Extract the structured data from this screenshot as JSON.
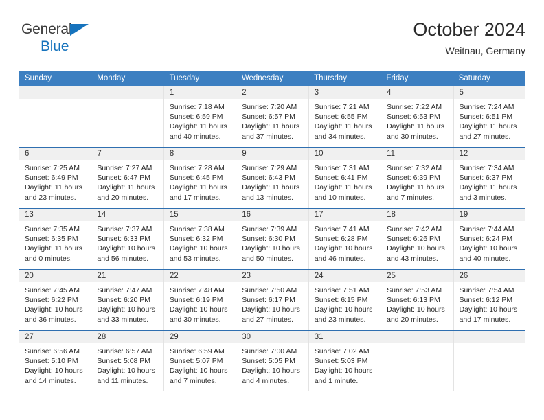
{
  "brand": {
    "name_line1": "General",
    "name_line2": "Blue",
    "color_dark": "#3a3a3a",
    "color_blue": "#1673bd"
  },
  "header": {
    "title": "October 2024",
    "subtitle": "Weitnau, Germany"
  },
  "theme": {
    "header_row_bg": "#3c7fc1",
    "week_divider": "#2f6fb0",
    "day_band_bg": "#f0f0f0"
  },
  "weekdays": [
    "Sunday",
    "Monday",
    "Tuesday",
    "Wednesday",
    "Thursday",
    "Friday",
    "Saturday"
  ],
  "weeks": [
    [
      {
        "day": "",
        "sunrise": "",
        "sunset": "",
        "daylight": ""
      },
      {
        "day": "",
        "sunrise": "",
        "sunset": "",
        "daylight": ""
      },
      {
        "day": "1",
        "sunrise": "Sunrise: 7:18 AM",
        "sunset": "Sunset: 6:59 PM",
        "daylight": "Daylight: 11 hours and 40 minutes."
      },
      {
        "day": "2",
        "sunrise": "Sunrise: 7:20 AM",
        "sunset": "Sunset: 6:57 PM",
        "daylight": "Daylight: 11 hours and 37 minutes."
      },
      {
        "day": "3",
        "sunrise": "Sunrise: 7:21 AM",
        "sunset": "Sunset: 6:55 PM",
        "daylight": "Daylight: 11 hours and 34 minutes."
      },
      {
        "day": "4",
        "sunrise": "Sunrise: 7:22 AM",
        "sunset": "Sunset: 6:53 PM",
        "daylight": "Daylight: 11 hours and 30 minutes."
      },
      {
        "day": "5",
        "sunrise": "Sunrise: 7:24 AM",
        "sunset": "Sunset: 6:51 PM",
        "daylight": "Daylight: 11 hours and 27 minutes."
      }
    ],
    [
      {
        "day": "6",
        "sunrise": "Sunrise: 7:25 AM",
        "sunset": "Sunset: 6:49 PM",
        "daylight": "Daylight: 11 hours and 23 minutes."
      },
      {
        "day": "7",
        "sunrise": "Sunrise: 7:27 AM",
        "sunset": "Sunset: 6:47 PM",
        "daylight": "Daylight: 11 hours and 20 minutes."
      },
      {
        "day": "8",
        "sunrise": "Sunrise: 7:28 AM",
        "sunset": "Sunset: 6:45 PM",
        "daylight": "Daylight: 11 hours and 17 minutes."
      },
      {
        "day": "9",
        "sunrise": "Sunrise: 7:29 AM",
        "sunset": "Sunset: 6:43 PM",
        "daylight": "Daylight: 11 hours and 13 minutes."
      },
      {
        "day": "10",
        "sunrise": "Sunrise: 7:31 AM",
        "sunset": "Sunset: 6:41 PM",
        "daylight": "Daylight: 11 hours and 10 minutes."
      },
      {
        "day": "11",
        "sunrise": "Sunrise: 7:32 AM",
        "sunset": "Sunset: 6:39 PM",
        "daylight": "Daylight: 11 hours and 7 minutes."
      },
      {
        "day": "12",
        "sunrise": "Sunrise: 7:34 AM",
        "sunset": "Sunset: 6:37 PM",
        "daylight": "Daylight: 11 hours and 3 minutes."
      }
    ],
    [
      {
        "day": "13",
        "sunrise": "Sunrise: 7:35 AM",
        "sunset": "Sunset: 6:35 PM",
        "daylight": "Daylight: 11 hours and 0 minutes."
      },
      {
        "day": "14",
        "sunrise": "Sunrise: 7:37 AM",
        "sunset": "Sunset: 6:33 PM",
        "daylight": "Daylight: 10 hours and 56 minutes."
      },
      {
        "day": "15",
        "sunrise": "Sunrise: 7:38 AM",
        "sunset": "Sunset: 6:32 PM",
        "daylight": "Daylight: 10 hours and 53 minutes."
      },
      {
        "day": "16",
        "sunrise": "Sunrise: 7:39 AM",
        "sunset": "Sunset: 6:30 PM",
        "daylight": "Daylight: 10 hours and 50 minutes."
      },
      {
        "day": "17",
        "sunrise": "Sunrise: 7:41 AM",
        "sunset": "Sunset: 6:28 PM",
        "daylight": "Daylight: 10 hours and 46 minutes."
      },
      {
        "day": "18",
        "sunrise": "Sunrise: 7:42 AM",
        "sunset": "Sunset: 6:26 PM",
        "daylight": "Daylight: 10 hours and 43 minutes."
      },
      {
        "day": "19",
        "sunrise": "Sunrise: 7:44 AM",
        "sunset": "Sunset: 6:24 PM",
        "daylight": "Daylight: 10 hours and 40 minutes."
      }
    ],
    [
      {
        "day": "20",
        "sunrise": "Sunrise: 7:45 AM",
        "sunset": "Sunset: 6:22 PM",
        "daylight": "Daylight: 10 hours and 36 minutes."
      },
      {
        "day": "21",
        "sunrise": "Sunrise: 7:47 AM",
        "sunset": "Sunset: 6:20 PM",
        "daylight": "Daylight: 10 hours and 33 minutes."
      },
      {
        "day": "22",
        "sunrise": "Sunrise: 7:48 AM",
        "sunset": "Sunset: 6:19 PM",
        "daylight": "Daylight: 10 hours and 30 minutes."
      },
      {
        "day": "23",
        "sunrise": "Sunrise: 7:50 AM",
        "sunset": "Sunset: 6:17 PM",
        "daylight": "Daylight: 10 hours and 27 minutes."
      },
      {
        "day": "24",
        "sunrise": "Sunrise: 7:51 AM",
        "sunset": "Sunset: 6:15 PM",
        "daylight": "Daylight: 10 hours and 23 minutes."
      },
      {
        "day": "25",
        "sunrise": "Sunrise: 7:53 AM",
        "sunset": "Sunset: 6:13 PM",
        "daylight": "Daylight: 10 hours and 20 minutes."
      },
      {
        "day": "26",
        "sunrise": "Sunrise: 7:54 AM",
        "sunset": "Sunset: 6:12 PM",
        "daylight": "Daylight: 10 hours and 17 minutes."
      }
    ],
    [
      {
        "day": "27",
        "sunrise": "Sunrise: 6:56 AM",
        "sunset": "Sunset: 5:10 PM",
        "daylight": "Daylight: 10 hours and 14 minutes."
      },
      {
        "day": "28",
        "sunrise": "Sunrise: 6:57 AM",
        "sunset": "Sunset: 5:08 PM",
        "daylight": "Daylight: 10 hours and 11 minutes."
      },
      {
        "day": "29",
        "sunrise": "Sunrise: 6:59 AM",
        "sunset": "Sunset: 5:07 PM",
        "daylight": "Daylight: 10 hours and 7 minutes."
      },
      {
        "day": "30",
        "sunrise": "Sunrise: 7:00 AM",
        "sunset": "Sunset: 5:05 PM",
        "daylight": "Daylight: 10 hours and 4 minutes."
      },
      {
        "day": "31",
        "sunrise": "Sunrise: 7:02 AM",
        "sunset": "Sunset: 5:03 PM",
        "daylight": "Daylight: 10 hours and 1 minute."
      },
      {
        "day": "",
        "sunrise": "",
        "sunset": "",
        "daylight": ""
      },
      {
        "day": "",
        "sunrise": "",
        "sunset": "",
        "daylight": ""
      }
    ]
  ]
}
